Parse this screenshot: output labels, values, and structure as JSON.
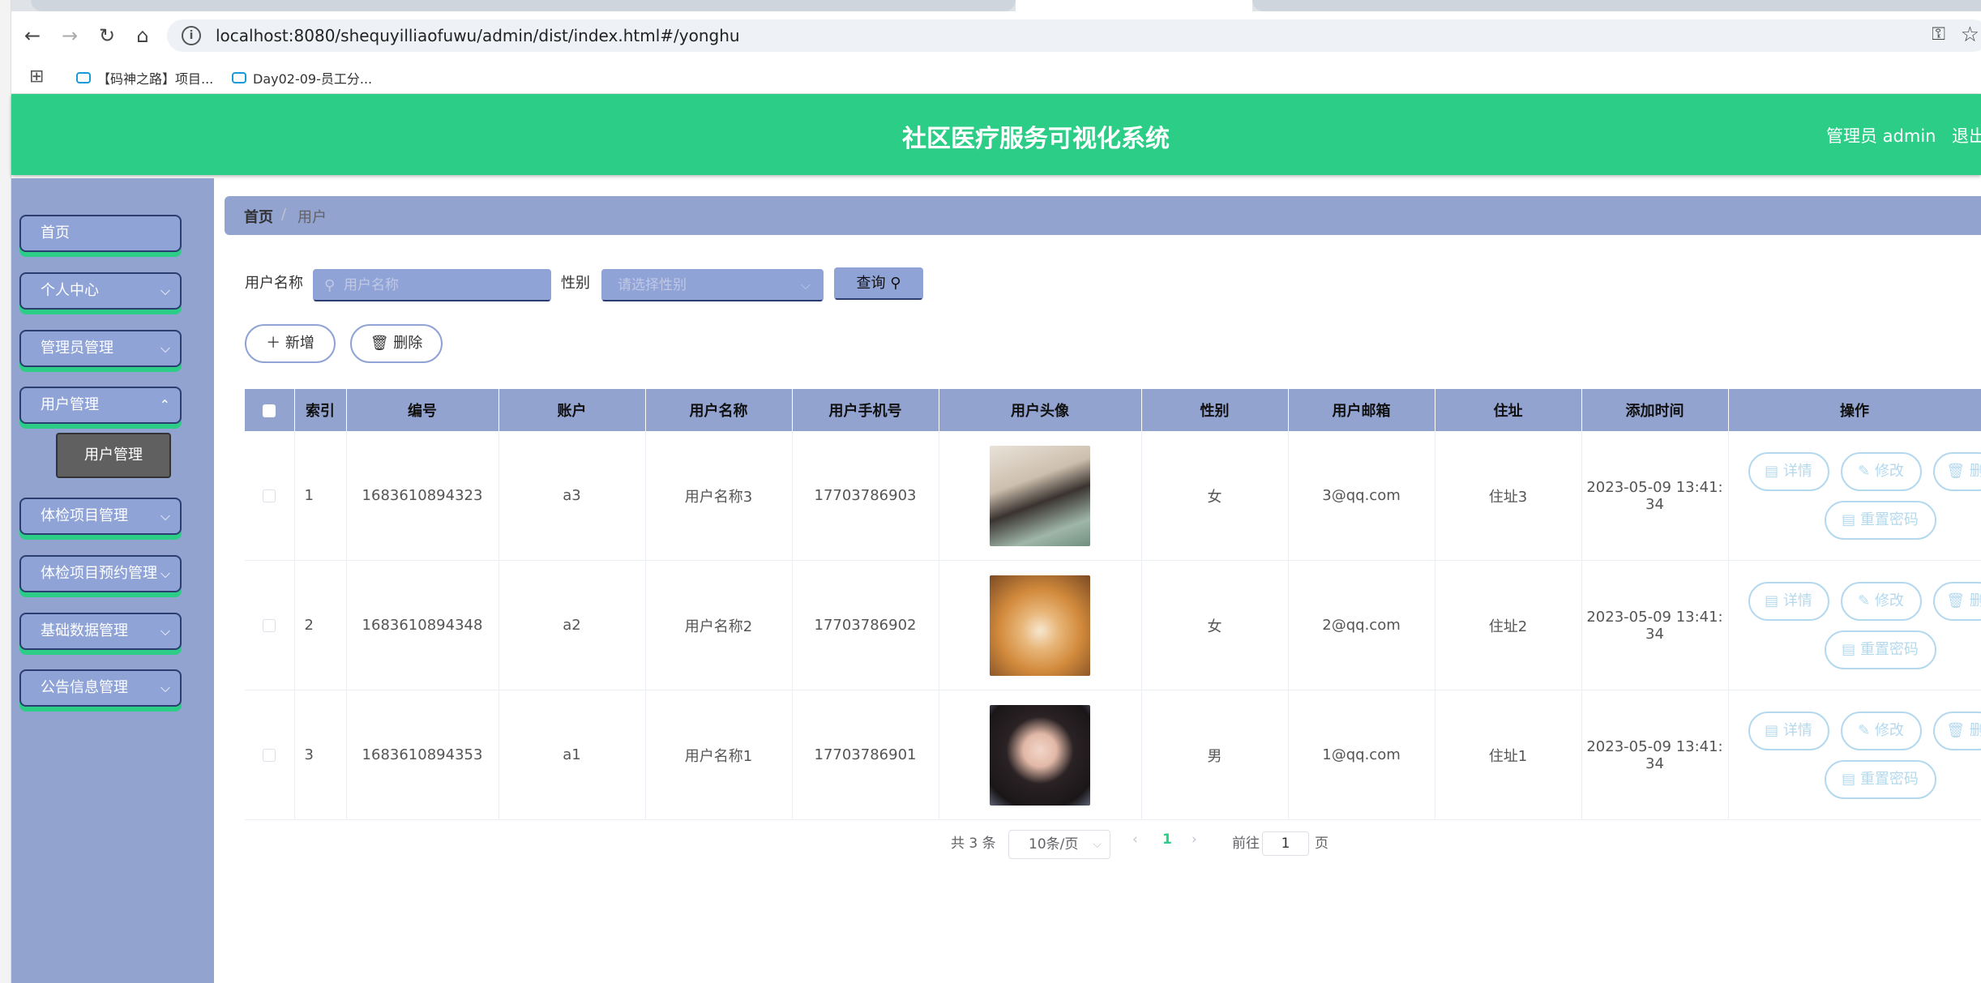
{
  "browser": {
    "url": "localhost:8080/shequyilliaofuwu/admin/dist/index.html#/yonghu",
    "bookmarks": [
      "【码神之路】项目...",
      "Day02-09-员工分..."
    ]
  },
  "header": {
    "title": "社区医疗服务可视化系统",
    "user": "管理员 admin",
    "logout": "退出"
  },
  "sidebar": {
    "items": [
      {
        "label": "首页"
      },
      {
        "label": "个人中心"
      },
      {
        "label": "管理员管理"
      },
      {
        "label": "用户管理"
      },
      {
        "label": "体检项目管理"
      },
      {
        "label": "体检项目预约管理"
      },
      {
        "label": "基础数据管理"
      },
      {
        "label": "公告信息管理"
      }
    ],
    "submenu_label": "用户管理"
  },
  "breadcrumb": {
    "home": "首页",
    "separator": "/",
    "current": "用户"
  },
  "filters": {
    "name_label": "用户名称",
    "name_placeholder": "用户名称",
    "gender_label": "性别",
    "gender_placeholder": "请选择性别",
    "query_label": "查询"
  },
  "actions": {
    "add": "新增",
    "delete": "删除"
  },
  "table": {
    "headers": [
      "索引",
      "编号",
      "账户",
      "用户名称",
      "用户手机号",
      "用户头像",
      "性别",
      "用户邮箱",
      "住址",
      "添加时间",
      "操作"
    ],
    "rows": [
      {
        "index": "1",
        "id": "1683610894323",
        "account": "a3",
        "name": "用户名称3",
        "phone": "17703786903",
        "gender": "女",
        "email": "3@qq.com",
        "address": "住址3",
        "time_a": "2023-05-09 13:41:",
        "time_b": "34"
      },
      {
        "index": "2",
        "id": "1683610894348",
        "account": "a2",
        "name": "用户名称2",
        "phone": "17703786902",
        "gender": "女",
        "email": "2@qq.com",
        "address": "住址2",
        "time_a": "2023-05-09 13:41:",
        "time_b": "34"
      },
      {
        "index": "3",
        "id": "1683610894353",
        "account": "a1",
        "name": "用户名称1",
        "phone": "17703786901",
        "gender": "男",
        "email": "1@qq.com",
        "address": "住址1",
        "time_a": "2023-05-09 13:41:",
        "time_b": "34"
      }
    ],
    "ops": {
      "detail": "详情",
      "edit": "修改",
      "delete": "删",
      "reset": "重置密码"
    }
  },
  "pagination": {
    "total": "共 3 条",
    "page_size": "10条/页",
    "current_page": "1",
    "goto_label": "前往",
    "goto_value": "1",
    "goto_suffix": "页"
  },
  "colors": {
    "header_green": "#2ccd86",
    "sidebar_blue": "#93a3d0",
    "menu_border": "#2c3e70",
    "op_button": "#b4d9ee"
  }
}
